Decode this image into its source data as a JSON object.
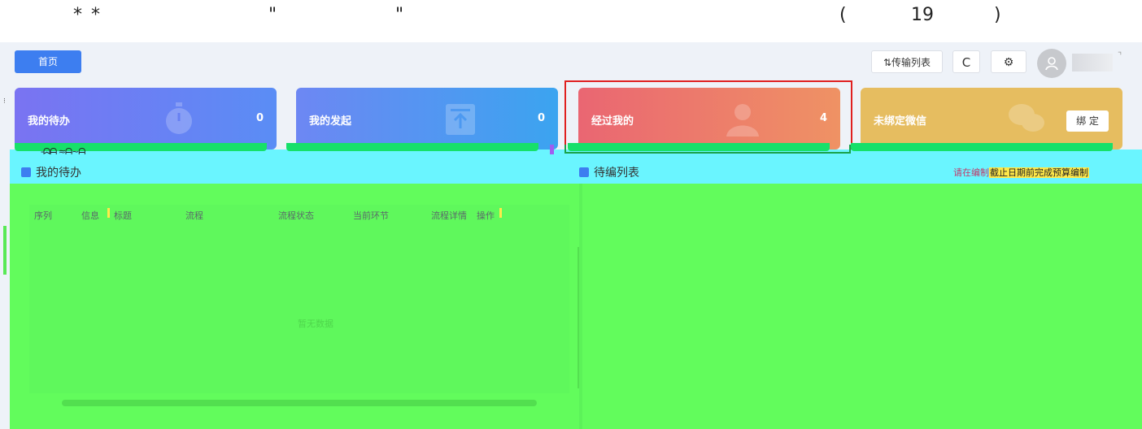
{
  "annotation": {
    "stars": "* *",
    "quote_open": "\"",
    "quote_close": "\"",
    "paren_open": "(",
    "number": "19",
    "paren_close": ")"
  },
  "topbar": {
    "home_tab": "首页",
    "transfer_button": "⇅传输列表",
    "refresh_icon": "C",
    "settings_icon": "⚙"
  },
  "cards": [
    {
      "label": "我的待办",
      "count": "0",
      "icon": "stopwatch-icon",
      "color": "#6f7ff4"
    },
    {
      "label": "我的发起",
      "count": "0",
      "icon": "upload-icon",
      "color": "#4a9af2"
    },
    {
      "label": "经过我的",
      "count": "4",
      "icon": "user-icon",
      "color": "#ec7a6a"
    },
    {
      "label": "未绑定微信",
      "bind_button": "绑 定",
      "icon": "wechat-icon",
      "color": "#e6bd60"
    }
  ],
  "strip_mark": "-ᗣᗩ ≈ᗩ~ᗩ",
  "todo_panel": {
    "title": "我的待办",
    "columns": [
      "序列",
      "信息",
      "标题",
      "流程",
      "流程状态",
      "当前环节",
      "流程详情",
      "操作"
    ],
    "empty_text": "暂无数据"
  },
  "pending_panel": {
    "title": "待编列表",
    "search_hint_pre": "请在编制",
    "search_hint_highlight": "截止日期前完成预算编制"
  },
  "colors": {
    "primary": "#3d7ef0",
    "highlight_border": "#e02020",
    "overlay_cyan": "#6af5ff",
    "overlay_green": "#62fc5c"
  }
}
